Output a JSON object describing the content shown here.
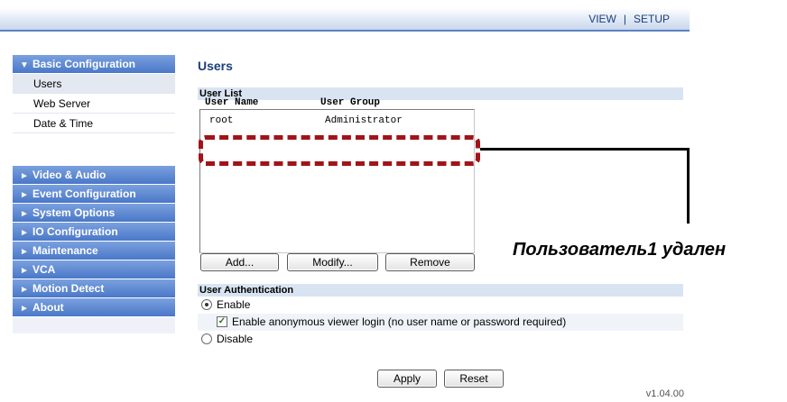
{
  "topnav": {
    "view": "VIEW",
    "separator": "|",
    "setup": "SETUP"
  },
  "sidebar": {
    "group": {
      "arrow": "▼",
      "label": "Basic Configuration"
    },
    "subitems": [
      "Users",
      "Web Server",
      "Date & Time"
    ],
    "sections": [
      {
        "arrow": "►",
        "label": "Video & Audio"
      },
      {
        "arrow": "►",
        "label": "Event Configuration"
      },
      {
        "arrow": "►",
        "label": "System Options"
      },
      {
        "arrow": "►",
        "label": "IO Configuration"
      },
      {
        "arrow": "►",
        "label": "Maintenance"
      },
      {
        "arrow": "►",
        "label": "VCA"
      },
      {
        "arrow": "►",
        "label": "Motion Detect"
      },
      {
        "arrow": "►",
        "label": "About"
      }
    ]
  },
  "main": {
    "title": "Users",
    "user_list": {
      "heading": "User List",
      "columns": [
        "User Name",
        "User Group"
      ],
      "rows": [
        {
          "name": "root",
          "group": "Administrator"
        }
      ],
      "buttons": {
        "add": "Add...",
        "modify": "Modify...",
        "remove": "Remove"
      }
    },
    "annotation": "Пользователь1 удален",
    "auth": {
      "heading": "User Authentication",
      "enable": "Enable",
      "anonymous": "Enable anonymous viewer login (no user name or password required)",
      "disable": "Disable",
      "enable_selected": true,
      "anonymous_checked": true
    },
    "actions": {
      "apply": "Apply",
      "reset": "Reset"
    },
    "version": "v1.04.00"
  },
  "colors": {
    "accent": "#4a78c8",
    "title": "#1a3f7a",
    "highlight": "#a0141a",
    "group_bg": "#d9e4f2"
  }
}
